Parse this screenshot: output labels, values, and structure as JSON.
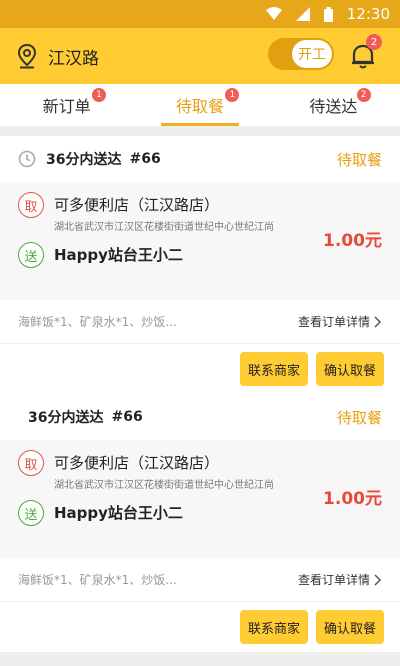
{
  "status_bar": {
    "time": "12:30"
  },
  "header": {
    "location": "江汉路",
    "toggle_label": "开工",
    "bell_badge": "2"
  },
  "tabs": [
    {
      "label": "新订单",
      "badge": "1"
    },
    {
      "label": "待取餐",
      "badge": "1"
    },
    {
      "label": "待送达",
      "badge": "2"
    }
  ],
  "orders": [
    {
      "deliver_time": "36分内送达",
      "order_no": "#66",
      "status": "待取餐",
      "pickup_tag": "取",
      "shop_name": "可多便利店（江汉路店）",
      "shop_address": "湖北省武汉市江汉区花楼街街道世纪中心世纪江尚",
      "send_tag": "送",
      "customer": "Happy站台王小二",
      "price": "1.00元",
      "items": "海鲜饭*1、矿泉水*1、炒饭...",
      "detail_link": "查看订单详情",
      "btn_contact": "联系商家",
      "btn_confirm": "确认取餐"
    },
    {
      "deliver_time": "36分内送达",
      "order_no": "#66",
      "status": "待取餐",
      "pickup_tag": "取",
      "shop_name": "可多便利店（江汉路店）",
      "shop_address": "湖北省武汉市江汉区花楼街街道世纪中心世纪江尚",
      "send_tag": "送",
      "customer": "Happy站台王小二",
      "price": "1.00元",
      "items": "海鲜饭*1、矿泉水*1、炒饭...",
      "detail_link": "查看订单详情",
      "btn_contact": "联系商家",
      "btn_confirm": "确认取餐"
    }
  ],
  "icons": {
    "location": "location-pin-icon",
    "bell": "bell-icon",
    "clock": "clock-icon",
    "chevron": "chevron-right-icon",
    "wifi": "wifi-icon",
    "signal": "signal-icon",
    "battery": "battery-icon"
  },
  "colors": {
    "accent": "#ffcc33",
    "status_bar": "#e6a71a",
    "price": "#e84a3a",
    "pickup": "#e05545",
    "send": "#4caa3a"
  }
}
